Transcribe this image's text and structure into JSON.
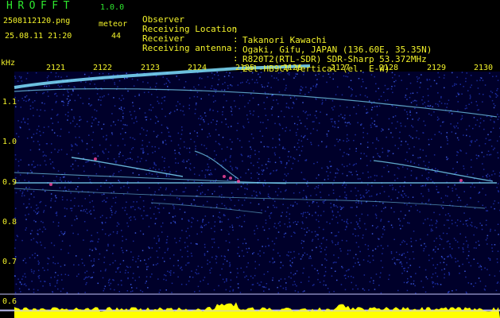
{
  "header": {
    "app_name": "HROFFT",
    "app_version": "1.0.0",
    "file_name": "2508112120.png",
    "meteor_label": "meteor",
    "date_time": "25.08.11 21:20",
    "meteor_count": "44"
  },
  "info": [
    {
      "label": "Observer",
      "value": "Takanori Kawachi"
    },
    {
      "label": "Receiving Location",
      "value": "Ogaki, Gifu, JAPAN (136.60E, 35.35N)"
    },
    {
      "label": "Receiver",
      "value": "R820T2(RTL-SDR) SDR-Sharp 53.372MHz"
    },
    {
      "label": "Receiving antenna",
      "value": "2el-HB9CV Vertical (el. E-W)"
    }
  ],
  "spectrogram": {
    "freq_unit": "kHz",
    "time_ticks": [
      "2121",
      "2122",
      "2123",
      "2124",
      "2125",
      "2126",
      "2127",
      "2128",
      "2129",
      "2130"
    ],
    "freq_ticks": [
      "1.1",
      "1.0",
      "0.9",
      "0.8",
      "0.7",
      "0.6"
    ],
    "colors": {
      "text": "#f2f22a",
      "title": "#2ee82e",
      "background": "#00002a",
      "noise": "#1a2a9a",
      "trace": "#7fe0ff",
      "hot": "#ff4aa0",
      "level": "#ffff00",
      "guide": "#c8c8ff"
    }
  }
}
